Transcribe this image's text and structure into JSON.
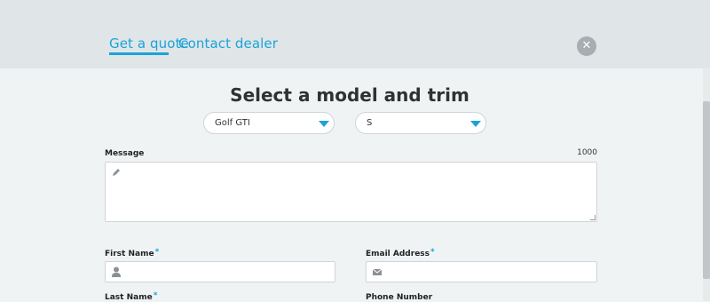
{
  "tabs": [
    {
      "label": "Get a quote",
      "active": true
    },
    {
      "label": "Contact dealer",
      "active": false
    }
  ],
  "close_label": "✕",
  "heading": "Select a model and trim",
  "selects": {
    "model": {
      "value": "Golf GTI",
      "icon": "chevron-down-icon"
    },
    "trim": {
      "value": "S",
      "icon": "chevron-down-icon"
    }
  },
  "message": {
    "label": "Message",
    "counter": "1000",
    "value": "",
    "icon": "pencil-icon"
  },
  "fields": {
    "first_name": {
      "label": "First Name",
      "required_mark": "*",
      "value": "",
      "icon": "person-icon"
    },
    "email": {
      "label": "Email Address",
      "required_mark": "*",
      "value": "",
      "icon": "envelope-icon"
    },
    "last_name": {
      "label": "Last Name",
      "required_mark": "*"
    },
    "phone": {
      "label": "Phone Number"
    }
  },
  "colors": {
    "accent": "#1aa3d9",
    "header_bg": "#e0e5e8",
    "page_bg": "#f0f3f4",
    "close_bg": "#a7adb1"
  }
}
